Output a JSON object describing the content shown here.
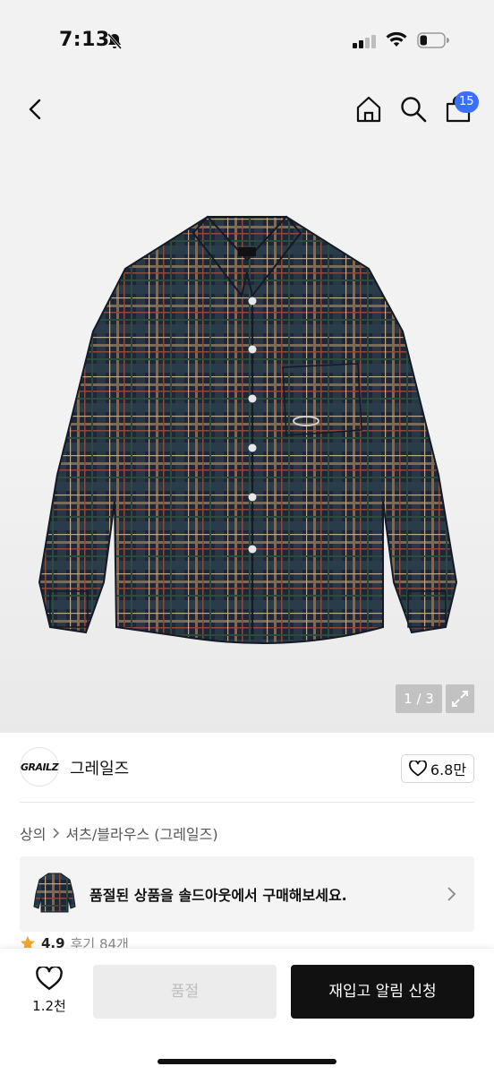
{
  "status_bar": {
    "time": "7:13",
    "silent_icon": "bell-slash-icon",
    "signal_icon": "signal-icon",
    "wifi_icon": "wifi-icon",
    "battery_icon": "battery-icon",
    "battery_level": 0.3
  },
  "nav": {
    "back_icon": "chevron-left-icon",
    "home_icon": "home-icon",
    "search_icon": "search-icon",
    "bag_icon": "shopping-bag-icon",
    "cart_count": "15",
    "badge_color": "#3b6ff5"
  },
  "gallery": {
    "image": "plaid-shirt-navy",
    "pager": "1 / 3",
    "expand_icon": "expand-icon"
  },
  "brand": {
    "logo_text": "GRAILZ",
    "name": "그레일즈",
    "like_icon": "heart-outline-icon",
    "like_count": "6.8만"
  },
  "breadcrumb": {
    "items": [
      "상의",
      "셔츠/블라우스 (그레일즈)"
    ]
  },
  "soldout_banner": {
    "text": "품절된 상품을 솔드아웃에서 구매해보세요.",
    "chevron_icon": "chevron-right-icon"
  },
  "rating": {
    "star_icon": "star-icon",
    "score": "4.9",
    "reviews": "후기 84개"
  },
  "bottom_bar": {
    "wish_icon": "heart-outline-icon",
    "wish_count": "1.2천",
    "soldout_label": "품절",
    "restock_label": "재입고 알림 신청"
  }
}
